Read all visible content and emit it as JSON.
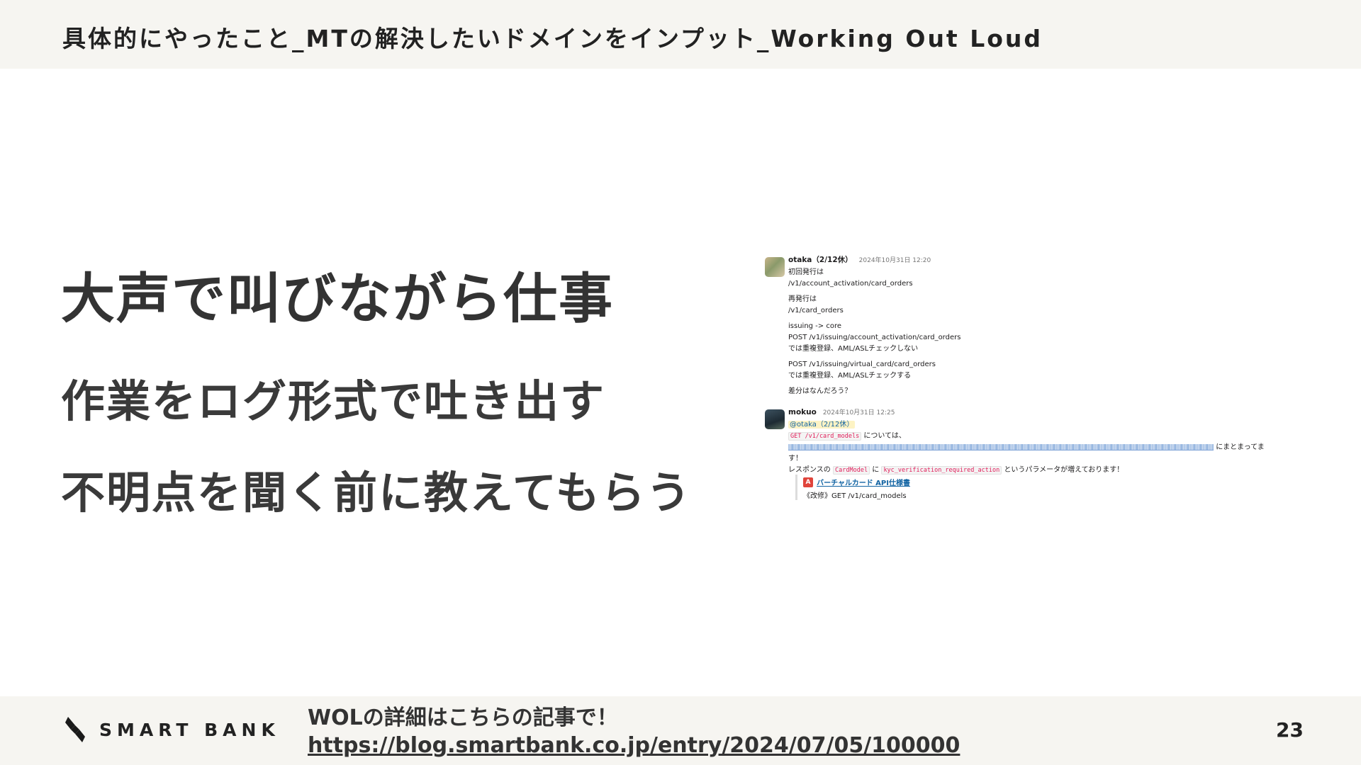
{
  "header": {
    "title": "具体的にやったこと_MTの解決したいドメインをインプット_Working Out Loud"
  },
  "main": {
    "headline": "大声で叫びながら仕事",
    "points": [
      "作業をログ形式で吐き出す",
      "不明点を聞く前に教えてもらう"
    ]
  },
  "slack": {
    "messages": [
      {
        "author": "otaka（2/12休）",
        "time": "2024年10月31日 12:20",
        "lines": [
          "初回発行は",
          "/v1/account_activation/card_orders",
          "",
          "再発行は",
          "/v1/card_orders",
          "",
          "issuing -> core",
          "POST /v1/issuing/account_activation/card_orders",
          "では重複登録、AML/ASLチェックしない",
          "",
          "POST /v1/issuing/virtual_card/card_orders",
          "では重複登録、AML/ASLチェックする",
          "",
          "差分はなんだろう？"
        ]
      },
      {
        "author": "mokuo",
        "time": "2024年10月31日 12:25",
        "mention": "@otaka（2/12休）",
        "code_endpoint": "GET /v1/card_models",
        "text_about": "については、",
        "text_summary": "にまとまってま",
        "text_end": "す！",
        "text_response": "レスポンスの",
        "code_model": "CardModel",
        "text_ni": "に",
        "code_param": "kyc_verification_required_action",
        "text_param_added": "というパラメータが増えております！",
        "attachment_icon": "A",
        "attachment_title": "バーチャルカード API仕様書",
        "attachment_sub": "《改修》GET /v1/card_models"
      }
    ]
  },
  "footer": {
    "logo_text": "SMART BANK",
    "note": "WOLの詳細はこちらの記事で！",
    "link": "https://blog.smartbank.co.jp/entry/2024/07/05/100000",
    "page_number": "23"
  }
}
